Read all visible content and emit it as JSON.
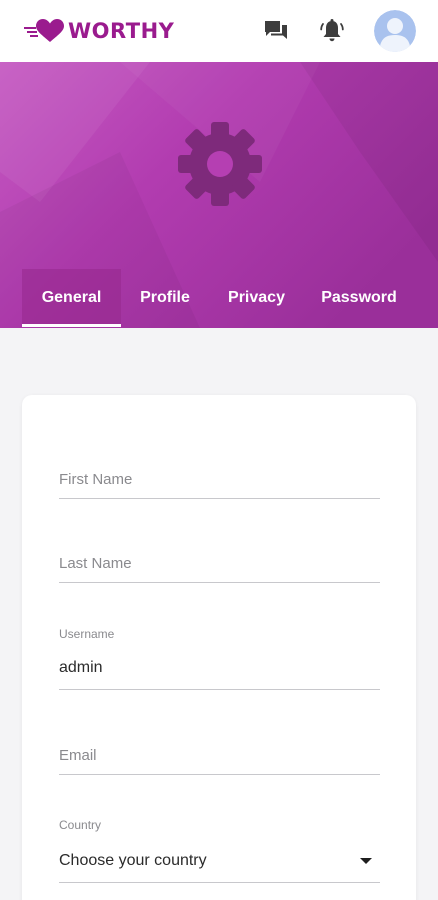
{
  "brand": {
    "name": "WORTHY",
    "color": "#9a1b8e"
  },
  "topbar": {
    "icons": [
      "chat-icon",
      "bell-icon",
      "avatar"
    ]
  },
  "hero": {
    "icon": "gear-icon",
    "gradient_start": "#c44fc0",
    "gradient_end": "#9d2c98"
  },
  "tabs": [
    {
      "label": "General",
      "active": true
    },
    {
      "label": "Profile",
      "active": false
    },
    {
      "label": "Privacy",
      "active": false
    },
    {
      "label": "Password",
      "active": false
    }
  ],
  "form": {
    "first_name": {
      "placeholder": "First Name",
      "value": ""
    },
    "last_name": {
      "placeholder": "Last Name",
      "value": ""
    },
    "username": {
      "label": "Username",
      "value": "admin"
    },
    "email": {
      "placeholder": "Email",
      "value": ""
    },
    "country": {
      "label": "Country",
      "value": "Choose your country"
    }
  }
}
